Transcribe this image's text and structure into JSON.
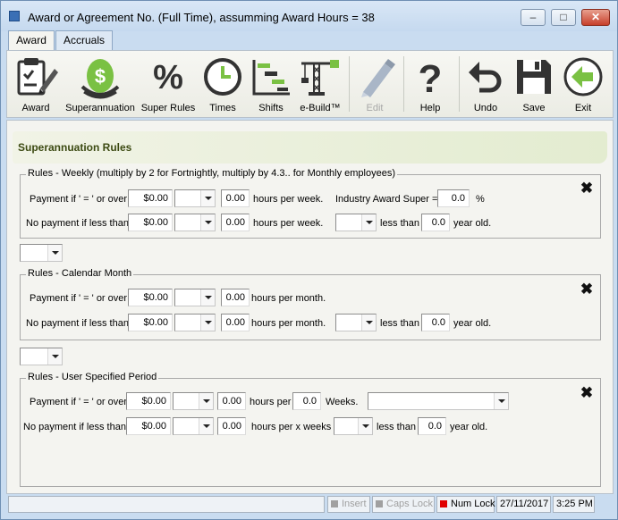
{
  "window": {
    "title": "Award or Agreement No.  (Full Time), assumming Award Hours = 38",
    "buttons": {
      "minimize": "–",
      "maximize": "□",
      "close": "✕"
    }
  },
  "tabs": [
    {
      "label": "Award",
      "active": true
    },
    {
      "label": "Accruals",
      "active": false
    }
  ],
  "toolbar": {
    "items": [
      {
        "label": "Award",
        "icon": "award-document-icon"
      },
      {
        "label": "Superannuation",
        "icon": "money-nest-egg-icon"
      },
      {
        "label": "Super Rules",
        "icon": "percent-icon"
      },
      {
        "label": "Times",
        "icon": "clock-icon"
      },
      {
        "label": "Shifts",
        "icon": "shifts-chart-icon"
      },
      {
        "label": "e-Build™",
        "icon": "crane-icon"
      },
      {
        "label": "Edit",
        "icon": "pencil-icon",
        "disabled": true
      },
      {
        "label": "Help",
        "icon": "question-icon"
      },
      {
        "label": "Undo",
        "icon": "undo-arrow-icon"
      },
      {
        "label": "Save",
        "icon": "floppy-disk-icon"
      },
      {
        "label": "Exit",
        "icon": "exit-arrow-icon"
      }
    ]
  },
  "section": {
    "title": "Superannuation Rules"
  },
  "weekly": {
    "legend": "Rules - Weekly (multiply by 2 for Fortnightly, multiply by 4.3.. for Monthly employees)",
    "row1": {
      "label": "Payment if ' = ' or over",
      "amount": "$0.00",
      "hours": "0.00",
      "hours_label": "hours per week.",
      "industry_label": "Industry Award Super =",
      "industry_value": "0.0",
      "percent": "%"
    },
    "row2": {
      "label": "No payment if less than",
      "amount": "$0.00",
      "hours": "0.00",
      "hours_label": "hours per week.",
      "less_than": "less than",
      "age": "0.0",
      "age_label": "year old."
    },
    "remove": "✖"
  },
  "monthly": {
    "legend": "Rules - Calendar Month",
    "row1": {
      "label": "Payment if ' = ' or over",
      "amount": "$0.00",
      "hours": "0.00",
      "hours_label": "hours per month."
    },
    "row2": {
      "label": "No payment if less than",
      "amount": "$0.00",
      "hours": "0.00",
      "hours_label": "hours per month.",
      "less_than": "less than",
      "age": "0.0",
      "age_label": "year old."
    },
    "remove": "✖"
  },
  "user_period": {
    "legend": "Rules - User Specified Period",
    "row1": {
      "label": "Payment if ' = ' or over",
      "amount": "$0.00",
      "hours": "0.00",
      "hours_label": "hours per",
      "weeks_value": "0.0",
      "weeks_label": "Weeks."
    },
    "row2": {
      "label": "No payment if less than",
      "amount": "$0.00",
      "hours": "0.00",
      "hours_label": "hours per x weeks",
      "less_than": "less than",
      "age": "0.0",
      "age_label": "year old."
    },
    "remove": "✖"
  },
  "statusbar": {
    "insert": "Insert",
    "caps_lock": "Caps Lock",
    "num_lock": "Num Lock",
    "date": "27/11/2017",
    "time": "3:25 PM"
  },
  "colors": {
    "num_lock_on": "#e00000",
    "indicator_off": "#a0a0a0",
    "section_title": "#3c4a12"
  }
}
